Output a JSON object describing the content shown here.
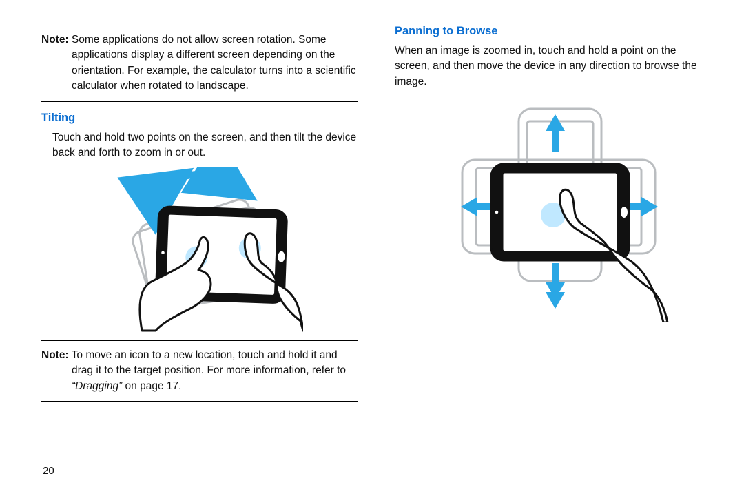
{
  "page_number": "20",
  "left": {
    "note1_label": "Note:",
    "note1_text": "Some applications do not allow screen rotation. Some applications display a different screen depending on the orientation. For example, the calculator turns into a scientific calculator when rotated to landscape.",
    "heading": "Tilting",
    "body": "Touch and hold two points on the screen, and then tilt the device back and forth to zoom in or out.",
    "note2_label": "Note:",
    "note2_a": "To move an icon to a new location, touch and hold it and drag it to the target position. For more information, refer to ",
    "note2_xref": "“Dragging”",
    "note2_b": " on page 17."
  },
  "right": {
    "heading": "Panning to Browse",
    "body": "When an image is zoomed in, touch and hold a point on the screen, and then move the device in any direction to browse the image."
  }
}
